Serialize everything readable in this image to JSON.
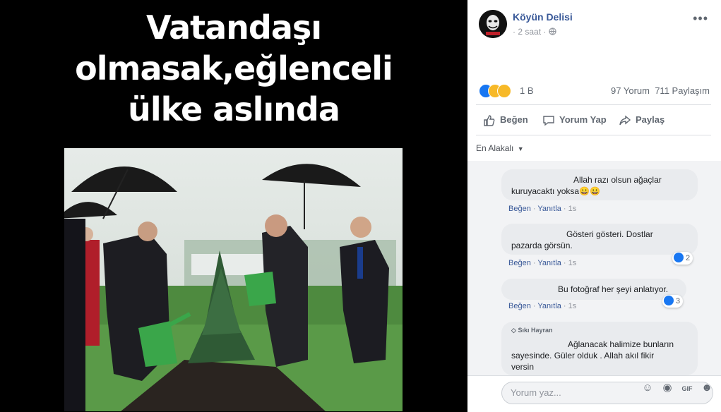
{
  "meme": {
    "caption_lines": [
      "Vatandaşı",
      "olmasak,eğlenceli",
      "ülke aslında"
    ]
  },
  "post": {
    "page_name": "Köyün Delisi",
    "time": "2 saat",
    "privacy_icon": "globe-icon",
    "reaction_count": "1 B",
    "comments_count": "97 Yorum",
    "shares_count": "711 Paylaşım"
  },
  "actions": {
    "like": "Beğen",
    "comment": "Yorum Yap",
    "share": "Paylaş"
  },
  "sort": {
    "label": "En Alakalı"
  },
  "comments": [
    {
      "line1": "Allah razı olsun ağaçlar",
      "line2": "kuruyacaktı yoksa😀😀",
      "like": "Beğen",
      "reply": "Yanıtla",
      "time": "1s",
      "likes": ""
    },
    {
      "line1": "Gösteri gösteri. Dostlar",
      "line2": "pazarda görsün.",
      "like": "Beğen",
      "reply": "Yanıtla",
      "time": "1s",
      "likes": "2"
    },
    {
      "line1": "Bu fotoğraf her şeyi anlatıyor.",
      "line2": "",
      "like": "Beğen",
      "reply": "Yanıtla",
      "time": "1s",
      "likes": "3"
    },
    {
      "badge": "Sıkı Hayran",
      "line1": "Ağlanacak halimize bunların",
      "line2": "sayesinde. Güler olduk . Allah akıl fikir",
      "line3": "versin"
    }
  ],
  "composer": {
    "placeholder": "Yorum yaz..."
  },
  "colors": {
    "link_blue": "#385898",
    "like_blue": "#1877f2",
    "bubble_gray": "#e9ebee"
  }
}
